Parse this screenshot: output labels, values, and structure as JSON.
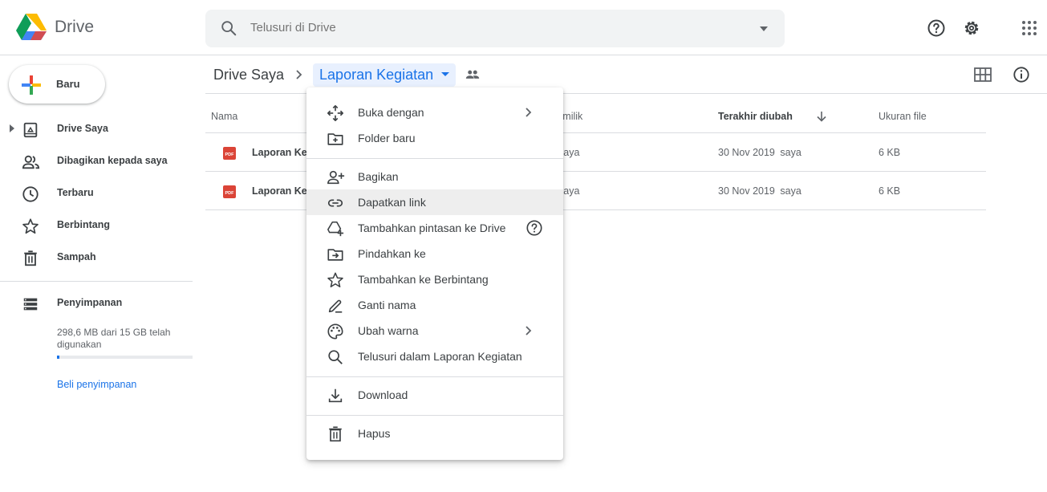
{
  "app": {
    "name": "Drive"
  },
  "search": {
    "placeholder": "Telusuri di Drive"
  },
  "toolbar": {
    "help_icon": "help-icon",
    "settings_icon": "gear-icon",
    "apps_icon": "apps-grid-icon"
  },
  "sidebar": {
    "new_label": "Baru",
    "items": [
      {
        "label": "Drive Saya",
        "icon": "my-drive-icon"
      },
      {
        "label": "Dibagikan kepada saya",
        "icon": "shared-people-icon"
      },
      {
        "label": "Terbaru",
        "icon": "clock-icon"
      },
      {
        "label": "Berbintang",
        "icon": "star-icon"
      },
      {
        "label": "Sampah",
        "icon": "trash-icon"
      }
    ],
    "storage_label": "Penyimpanan",
    "storage_text": "298,6 MB dari 15 GB telah digunakan",
    "storage_used_fraction": 0.02,
    "buy_label": "Beli penyimpanan"
  },
  "breadcrumb": {
    "root": "Drive Saya",
    "current": "Laporan Kegiatan"
  },
  "table": {
    "columns": {
      "name": "Nama",
      "owner": "Pemilik",
      "modified": "Terakhir diubah",
      "size": "Ukuran file"
    },
    "rows": [
      {
        "name": "Laporan Kegiatan",
        "owner": "saya",
        "modified": "30 Nov 2019",
        "modified_by": "saya",
        "size": "6 KB"
      },
      {
        "name": "Laporan Kegiatan",
        "owner": "saya",
        "modified": "30 Nov 2019",
        "modified_by": "saya",
        "size": "6 KB"
      }
    ]
  },
  "context_menu": {
    "items": [
      {
        "label": "Buka dengan"
      },
      {
        "label": "Folder baru"
      },
      {
        "label": "Bagikan"
      },
      {
        "label": "Dapatkan link"
      },
      {
        "label": "Tambahkan pintasan ke Drive"
      },
      {
        "label": "Pindahkan ke"
      },
      {
        "label": "Tambahkan ke Berbintang"
      },
      {
        "label": "Ganti nama"
      },
      {
        "label": "Ubah warna"
      },
      {
        "label": "Telusuri dalam Laporan Kegiatan"
      },
      {
        "label": "Download"
      },
      {
        "label": "Hapus"
      }
    ]
  },
  "colors": {
    "accent": "#1a73e8",
    "pdf_red": "#db4437",
    "highlight": "#eeeeee"
  }
}
